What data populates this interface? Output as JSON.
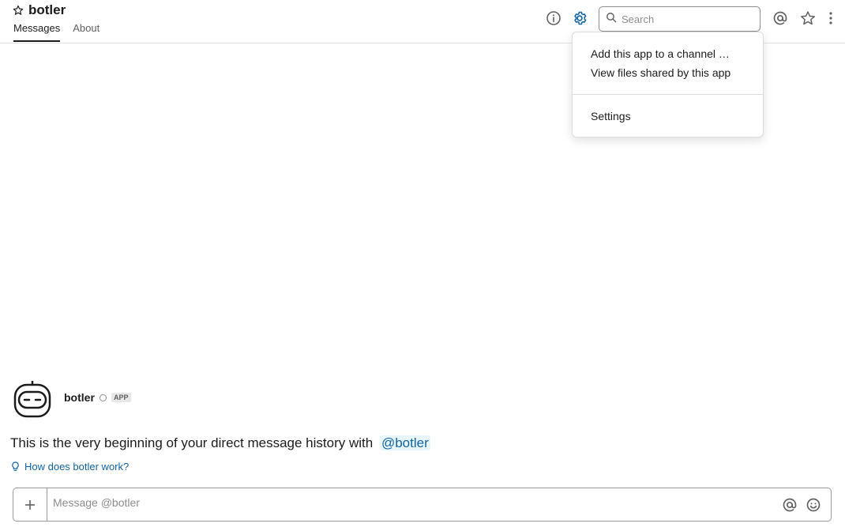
{
  "header": {
    "channel_name": "botler",
    "tabs": [
      {
        "label": "Messages",
        "active": true
      },
      {
        "label": "About",
        "active": false
      }
    ],
    "search": {
      "placeholder": "Search"
    }
  },
  "menu": {
    "items": [
      {
        "label": "Add this app to a channel …"
      },
      {
        "label": "View files shared by this app"
      },
      {
        "label": "Settings"
      }
    ]
  },
  "intro": {
    "bot_name": "botler",
    "badge": "APP",
    "history_text": "This is the very beginning of your direct message history with",
    "mention": "@botler",
    "help_link": "How does botler work?"
  },
  "composer": {
    "placeholder": "Message @botler"
  },
  "colors": {
    "accent": "#1264a3",
    "settings_icon": "#1264a3",
    "text": "#1d1c1d",
    "muted": "#616061"
  },
  "icons": [
    "star-icon",
    "info-icon",
    "gear-icon",
    "search-icon",
    "at-sign-icon",
    "star-outline-icon",
    "more-vertical-icon",
    "bot-avatar",
    "lightbulb-icon",
    "plus-icon",
    "emoji-icon"
  ]
}
